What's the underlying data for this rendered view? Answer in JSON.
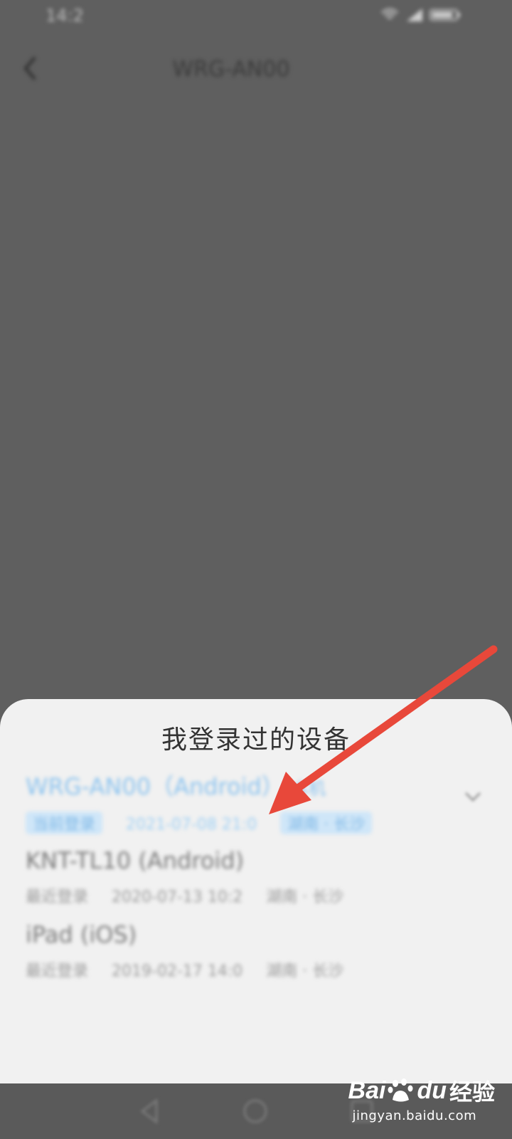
{
  "status_bar": {
    "time": "14:2",
    "icons": "wifi-icon signal-icon battery-icon"
  },
  "top_bar": {
    "title": "WRG-AN00"
  },
  "sheet": {
    "title": "我登录过的设备",
    "devices": [
      {
        "name": "WRG-AN00（Android）",
        "tag": "本机",
        "status": "当前登录",
        "time": "2021-07-08 21:0",
        "location": "湖南 · 长沙",
        "current": true
      },
      {
        "name": "KNT-TL10 (Android)",
        "status": "最近登录",
        "time": "2020-07-13 10:2",
        "location": "湖南 · 长沙",
        "current": false
      },
      {
        "name": "iPad (iOS)",
        "status": "最近登录",
        "time": "2019-02-17 14:0",
        "location": "湖南 · 长沙",
        "current": false
      }
    ]
  },
  "colors": {
    "overlay": "#5f5f5f",
    "sheet_bg": "#f1f1f1",
    "arrow": "#e8483a",
    "accent": "#8bc3ef"
  },
  "watermark": {
    "logo_left": "Bai",
    "logo_right": "du",
    "brand": "经验",
    "url": "jingyan.baidu.com"
  }
}
